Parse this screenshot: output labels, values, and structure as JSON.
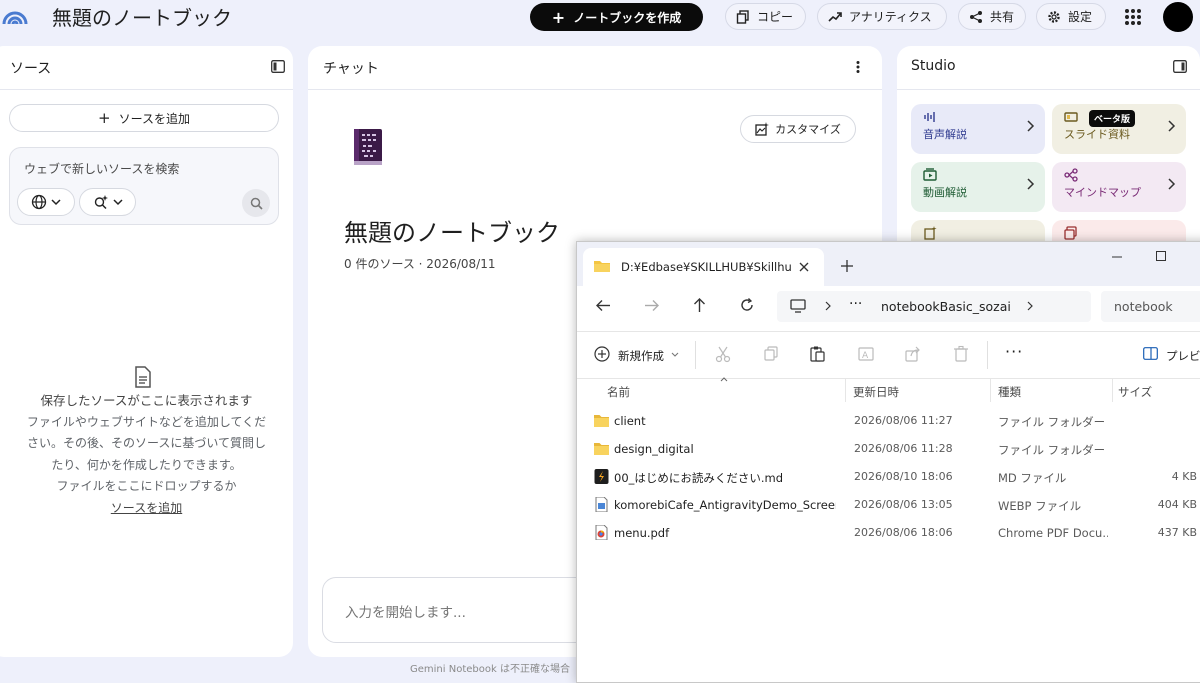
{
  "app": {
    "title": "無題のノートブック",
    "create_label": "ノートブックを作成",
    "copy_label": "コピー",
    "analytics_label": "アナリティクス",
    "share_label": "共有",
    "settings_label": "設定"
  },
  "sources": {
    "header": "ソース",
    "add_label": "ソースを追加",
    "search_placeholder": "ウェブで新しいソースを検索",
    "empty_title": "保存したソースがここに表示されます",
    "empty_line1": "ファイルやウェブサイトなどを追加してくだ",
    "empty_line2": "さい。その後、そのソースに基づいて質問し",
    "empty_line3": "たり、何かを作成したりできます。",
    "empty_line4": "ファイルをここにドロップするか",
    "empty_link": "ソースを追加"
  },
  "chat": {
    "header": "チャット",
    "customize_label": "カスタマイズ",
    "title": "無題のノートブック",
    "meta": "0 件のソース · 2026/08/11",
    "input_placeholder": "入力を開始します...",
    "footer": "Gemini Notebook は不正確な場合"
  },
  "studio": {
    "header": "Studio",
    "cards": [
      {
        "label": "音声解説",
        "bg": "#e8eaf8",
        "color": "#2f3a8f"
      },
      {
        "label": "スライド資料",
        "bg": "#f1efe3",
        "color": "#6b5a1f",
        "badge": "ベータ版"
      },
      {
        "label": "動画解説",
        "bg": "#e6f2ea",
        "color": "#1f5c34"
      },
      {
        "label": "マインドマップ",
        "bg": "#f3e9f3",
        "color": "#7a2b76"
      }
    ]
  },
  "explorer": {
    "tab_title": "D:¥Edbase¥SKILLHUB¥Skillhub",
    "breadcrumb": "notebookBasic_sozai",
    "search_placeholder": "notebook",
    "new_label": "新規作成",
    "preview_label": "プレビュー",
    "columns": [
      "名前",
      "更新日時",
      "種類",
      "サイズ"
    ],
    "files": [
      {
        "name": "client",
        "date": "2026/08/06 11:27",
        "type": "ファイル フォルダー",
        "size": "",
        "icon": "folder-icon"
      },
      {
        "name": "design_digital",
        "date": "2026/08/06 11:28",
        "type": "ファイル フォルダー",
        "size": "",
        "icon": "folder-icon"
      },
      {
        "name": "00_はじめにお読みください.md",
        "date": "2026/08/10 18:06",
        "type": "MD ファイル",
        "size": "4 KB",
        "icon": "md-file-icon"
      },
      {
        "name": "komorebiCafe_AntigravityDemo_Screens...",
        "date": "2026/08/06 13:05",
        "type": "WEBP ファイル",
        "size": "404 KB",
        "icon": "webp-file-icon"
      },
      {
        "name": "menu.pdf",
        "date": "2026/08/06 18:06",
        "type": "Chrome PDF Docu...",
        "size": "437 KB",
        "icon": "pdf-file-icon"
      }
    ]
  }
}
